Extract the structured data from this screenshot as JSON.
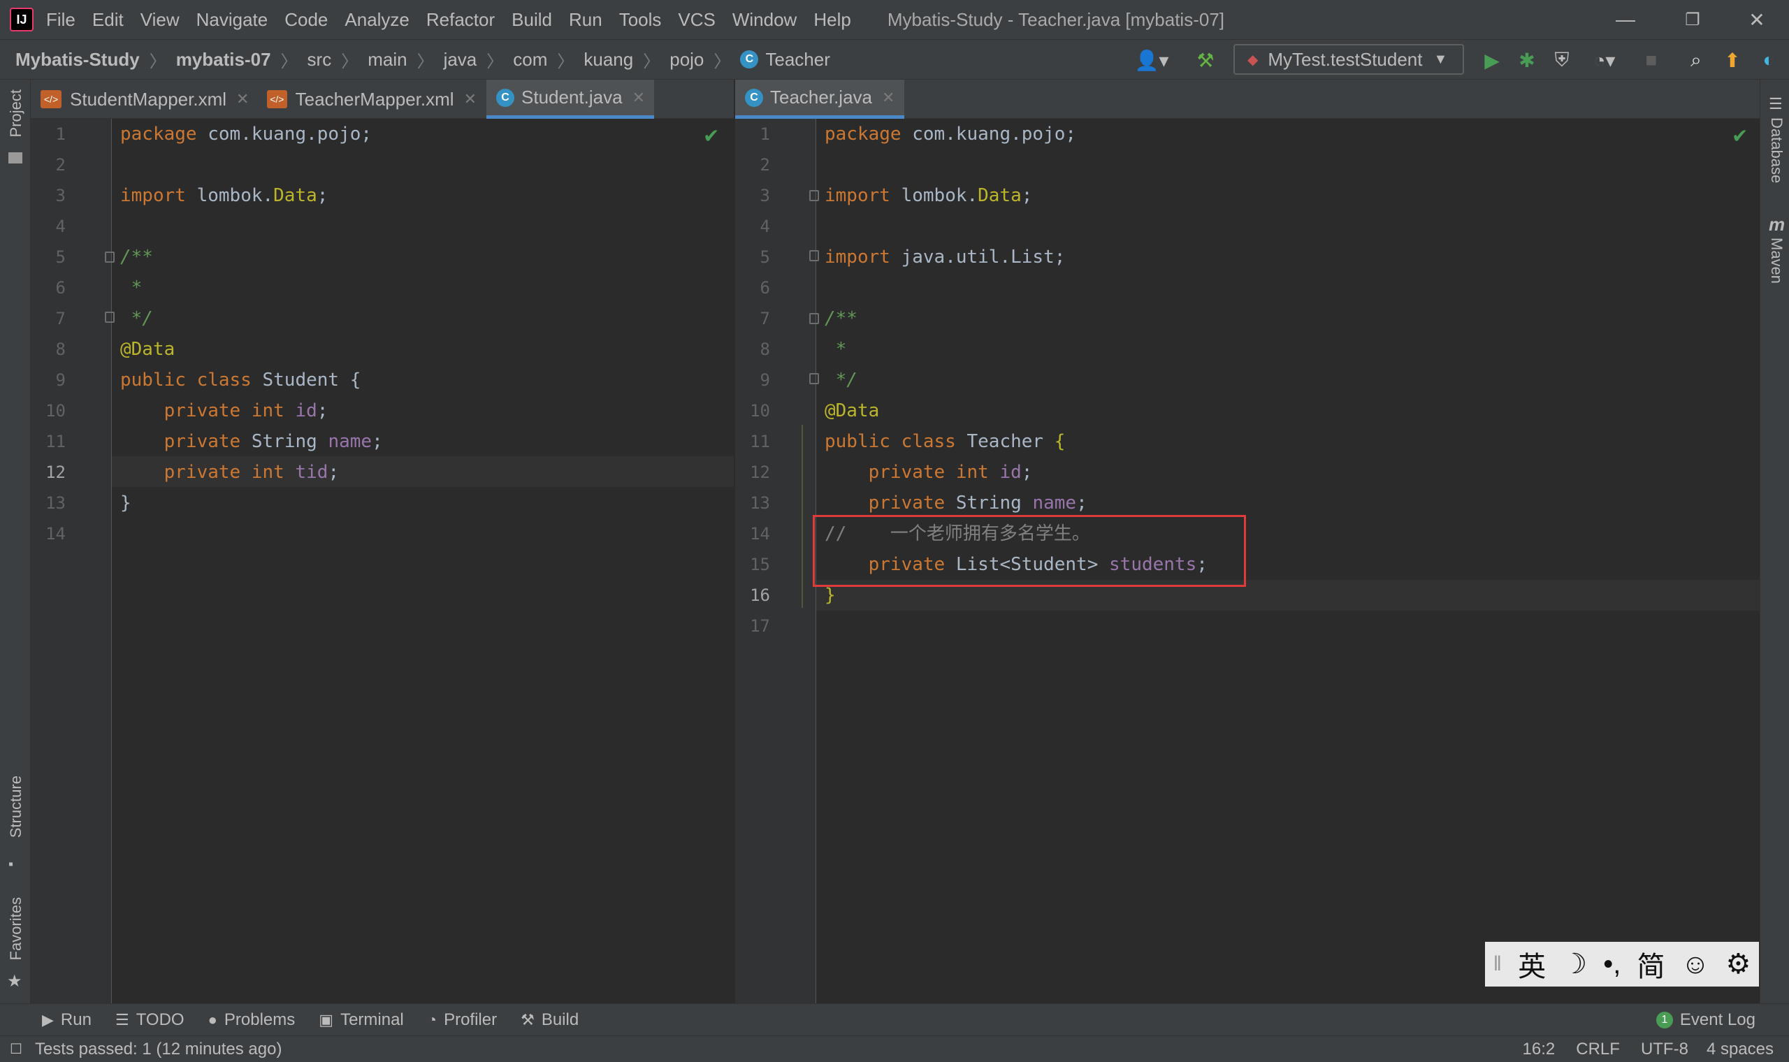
{
  "menubar": {
    "items": [
      "File",
      "Edit",
      "View",
      "Navigate",
      "Code",
      "Analyze",
      "Refactor",
      "Build",
      "Run",
      "Tools",
      "VCS",
      "Window",
      "Help"
    ],
    "title": "Mybatis-Study - Teacher.java [mybatis-07]"
  },
  "breadcrumb": [
    "Mybatis-Study",
    "mybatis-07",
    "src",
    "main",
    "java",
    "com",
    "kuang",
    "pojo",
    "Teacher"
  ],
  "run_config": "MyTest.testStudent",
  "tabs_left": [
    {
      "label": "StudentMapper.xml"
    },
    {
      "label": "TeacherMapper.xml"
    },
    {
      "label": "Student.java"
    }
  ],
  "tabs_right": [
    {
      "label": "Teacher.java"
    }
  ],
  "side_left": {
    "project": "Project",
    "structure": "Structure",
    "favorites": "Favorites"
  },
  "side_right": {
    "database": "Database",
    "maven": "Maven",
    "maven_glyph": "m"
  },
  "editor_left": {
    "line_numbers": [
      "1",
      "2",
      "3",
      "4",
      "5",
      "6",
      "7",
      "8",
      "9",
      "10",
      "11",
      "12",
      "13",
      "14"
    ],
    "lines": [
      [
        [
          "kw",
          "package "
        ],
        [
          "",
          "com.kuang.pojo;"
        ]
      ],
      [],
      [
        [
          "kw",
          "import "
        ],
        [
          "",
          "lombok."
        ],
        [
          "ann",
          "Data"
        ],
        [
          "",
          ";"
        ]
      ],
      [],
      [
        [
          "cm",
          "/**"
        ]
      ],
      [
        [
          "cm",
          " *"
        ]
      ],
      [
        [
          "cm",
          " */"
        ]
      ],
      [
        [
          "ann",
          "@Data"
        ]
      ],
      [
        [
          "kw",
          "public class "
        ],
        [
          "",
          "Student {"
        ]
      ],
      [
        [
          "",
          "    "
        ],
        [
          "kw",
          "private int "
        ],
        [
          "fld",
          "id"
        ],
        [
          "",
          ";"
        ]
      ],
      [
        [
          "",
          "    "
        ],
        [
          "kw",
          "private "
        ],
        [
          "",
          "String "
        ],
        [
          "fld",
          "name"
        ],
        [
          "",
          ";"
        ]
      ],
      [
        [
          "",
          "    "
        ],
        [
          "kw",
          "private int "
        ],
        [
          "fld",
          "tid"
        ],
        [
          "",
          ";"
        ]
      ],
      [
        [
          "",
          "}"
        ]
      ],
      []
    ]
  },
  "editor_right": {
    "line_numbers": [
      "1",
      "2",
      "3",
      "4",
      "5",
      "6",
      "7",
      "8",
      "9",
      "10",
      "11",
      "12",
      "13",
      "14",
      "15",
      "16",
      "17"
    ],
    "lines": [
      [
        [
          "kw",
          "package "
        ],
        [
          "",
          "com.kuang.pojo;"
        ]
      ],
      [],
      [
        [
          "kw",
          "import "
        ],
        [
          "",
          "lombok."
        ],
        [
          "ann",
          "Data"
        ],
        [
          "",
          ";"
        ]
      ],
      [],
      [
        [
          "kw",
          "import "
        ],
        [
          "",
          "java.util.List;"
        ]
      ],
      [],
      [
        [
          "cm",
          "/**"
        ]
      ],
      [
        [
          "cm",
          " *"
        ]
      ],
      [
        [
          "cm",
          " */"
        ]
      ],
      [
        [
          "ann",
          "@Data"
        ]
      ],
      [
        [
          "kw",
          "public class "
        ],
        [
          "",
          "Teacher "
        ],
        [
          "ann",
          "{"
        ]
      ],
      [
        [
          "",
          "    "
        ],
        [
          "kw",
          "private int "
        ],
        [
          "fld",
          "id"
        ],
        [
          "",
          ";"
        ]
      ],
      [
        [
          "",
          "    "
        ],
        [
          "kw",
          "private "
        ],
        [
          "",
          "String "
        ],
        [
          "fld",
          "name"
        ],
        [
          "",
          ";"
        ]
      ],
      [
        [
          "lc",
          "//    一个老师拥有多名学生。"
        ]
      ],
      [
        [
          "",
          "    "
        ],
        [
          "kw",
          "private "
        ],
        [
          "",
          "List<Student> "
        ],
        [
          "fld",
          "students"
        ],
        [
          "",
          ";"
        ]
      ],
      [
        [
          "ann",
          "}"
        ]
      ],
      []
    ]
  },
  "ime": [
    "英",
    "☽",
    "•,",
    "简",
    "☺",
    "⚙"
  ],
  "bottom_tools": [
    "Run",
    "TODO",
    "Problems",
    "Terminal",
    "Profiler",
    "Build"
  ],
  "event_log": "Event Log",
  "event_count": "1",
  "status": {
    "message": "Tests passed: 1 (12 minutes ago)",
    "position": "16:2",
    "line_sep": "CRLF",
    "encoding": "UTF-8",
    "indent": "4 spaces"
  }
}
